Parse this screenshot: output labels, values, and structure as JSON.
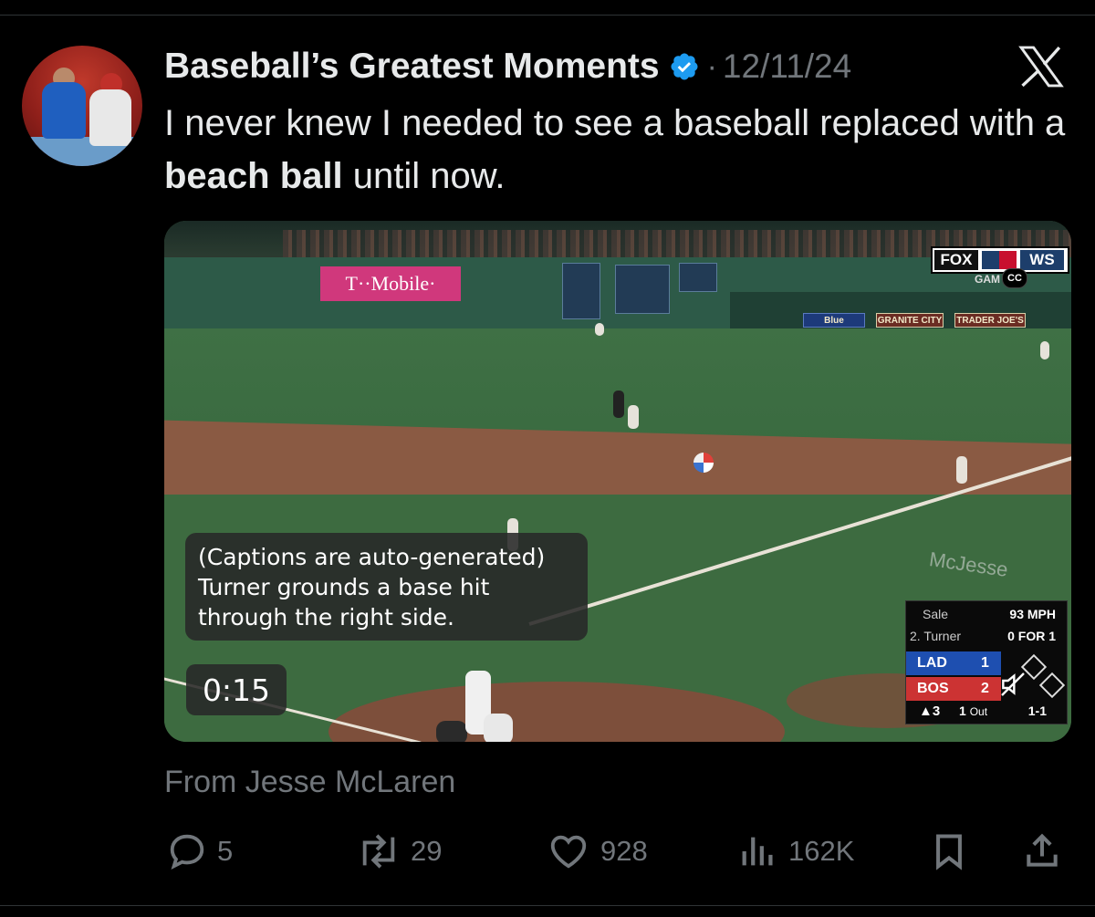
{
  "tweet": {
    "display_name": "Baseball’s Greatest Moments",
    "separator": "·",
    "date": "12/11/24",
    "text_part1": "I never knew I needed to see a baseball replaced with a ",
    "text_bold": "beach ball",
    "text_part2": " until now.",
    "attribution": "From Jesse McLaren"
  },
  "video": {
    "captions": [
      "(Captions are auto-generated)",
      "Turner grounds a base hit",
      "through the right side."
    ],
    "time": "0:15",
    "ad_tmobile": "T··Mobile·",
    "ads": [
      "Blue",
      "GRANITE CITY",
      "TRADER JOE'S"
    ],
    "network": "FOX",
    "series": "WS",
    "network_sub": "GAM",
    "cc_label": "CC",
    "watermark": "McJesse",
    "scorebug": {
      "pitcher": "Sale",
      "pitch_speed": "93 MPH",
      "batter": "2. Turner",
      "batter_line": "0 FOR 1",
      "away_team": "LAD",
      "away_score": "1",
      "home_team": "BOS",
      "home_score": "2",
      "inning": "▲3",
      "outs": "1",
      "outs_label": "Out",
      "count": "1-1"
    }
  },
  "actions": {
    "replies": "5",
    "reposts": "29",
    "likes": "928",
    "views": "162K"
  },
  "colors": {
    "background": "#000000",
    "text": "#e7e9ea",
    "muted": "#71767b",
    "verified": "#1d9bf0"
  }
}
